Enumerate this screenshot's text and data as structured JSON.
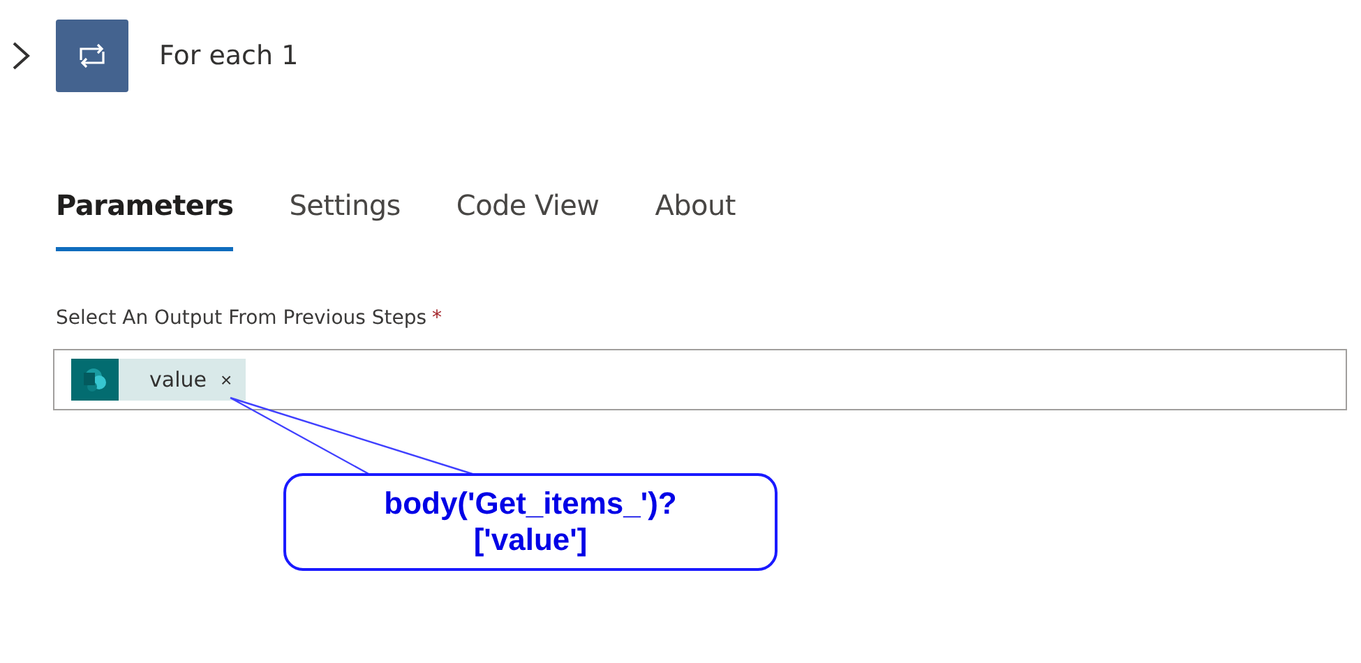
{
  "header": {
    "expanded": false,
    "title": "For each 1"
  },
  "tabs": [
    {
      "label": "Parameters",
      "selected": true
    },
    {
      "label": "Settings",
      "selected": false
    },
    {
      "label": "Code View",
      "selected": false
    },
    {
      "label": "About",
      "selected": false
    }
  ],
  "field": {
    "label": "Select An Output From Previous Steps",
    "required_mark": "*",
    "token": {
      "label": "value",
      "remove": "×"
    }
  },
  "callout": {
    "lines": [
      "body('Get_items_')?",
      "['value']"
    ]
  }
}
